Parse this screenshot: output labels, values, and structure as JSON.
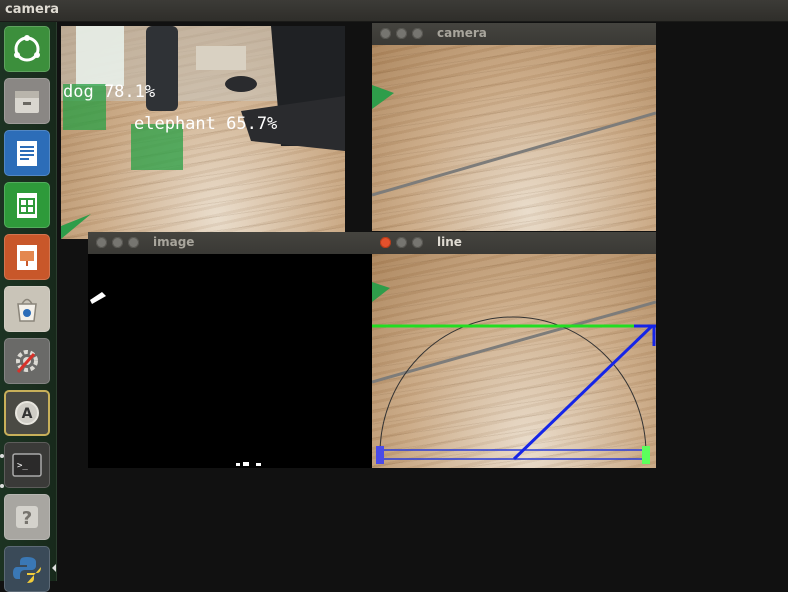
{
  "top_panel": {
    "title": "camera"
  },
  "launcher": {
    "items": [
      {
        "name": "ubuntu-dash-icon",
        "glyph": "◎",
        "bg": "#3c8f3c"
      },
      {
        "name": "files-icon",
        "glyph": "▤",
        "bg": "#8a8784"
      },
      {
        "name": "writer-icon",
        "glyph": "≣",
        "bg": "#2c6db8"
      },
      {
        "name": "calc-icon",
        "glyph": "▦",
        "bg": "#2e9a3a"
      },
      {
        "name": "impress-icon",
        "glyph": "▣",
        "bg": "#c8572a"
      },
      {
        "name": "software-center-icon",
        "glyph": "◫",
        "bg": "#c9c4b8"
      },
      {
        "name": "system-settings-icon",
        "glyph": "⚙",
        "bg": "#6a6a68"
      },
      {
        "name": "software-updater-icon",
        "glyph": "A",
        "bg": "#7a7a70"
      },
      {
        "name": "terminal-icon",
        "glyph": ">_",
        "bg": "#3a3a38"
      },
      {
        "name": "help-icon",
        "glyph": "?",
        "bg": "#a8a6a1"
      },
      {
        "name": "python-icon",
        "glyph": "◆",
        "bg": "#3a6ea5"
      }
    ]
  },
  "windows": {
    "detect": {
      "labels": [
        "dog 78.1%",
        "elephant 65.7%"
      ]
    },
    "camera": {
      "title": "camera"
    },
    "image": {
      "title": "image"
    },
    "line": {
      "title": "line"
    }
  }
}
